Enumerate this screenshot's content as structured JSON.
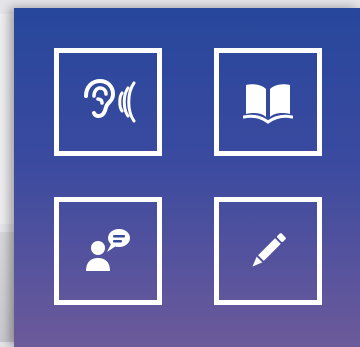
{
  "colors": {
    "panel_top": "#27479c",
    "panel_bottom": "#6c5a9a",
    "tile_border": "#ffffff",
    "icon": "#ffffff"
  },
  "tiles": [
    {
      "icon": "ear-sound-icon"
    },
    {
      "icon": "open-book-icon"
    },
    {
      "icon": "person-speech-bubble-icon"
    },
    {
      "icon": "pencil-icon"
    }
  ]
}
